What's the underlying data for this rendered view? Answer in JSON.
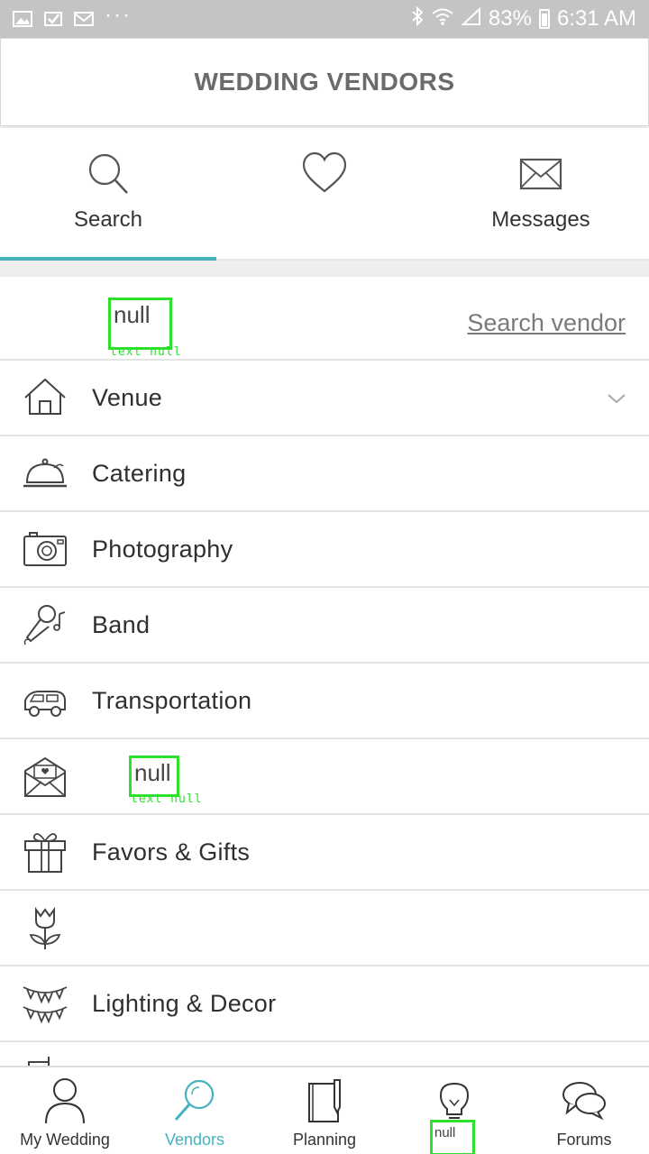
{
  "status_bar": {
    "battery": "83%",
    "time": "6:31 AM",
    "icons": [
      "image-icon",
      "check-icon",
      "gmail-icon",
      "more-dots-icon",
      "bluetooth-icon",
      "wifi-icon",
      "signal-icon",
      "battery-icon"
    ]
  },
  "header": {
    "title": "WEDDING VENDORS"
  },
  "tabs": [
    {
      "label": "Search",
      "icon": "search-icon",
      "active": true
    },
    {
      "label": "",
      "icon": "heart-icon",
      "active": false
    },
    {
      "label": "Messages",
      "icon": "envelope-icon",
      "active": false
    }
  ],
  "search": {
    "null_text": "null",
    "null_caption": "text null",
    "link": "Search vendor"
  },
  "categories": [
    {
      "label": "Venue",
      "icon": "house-icon",
      "expandable": true
    },
    {
      "label": "Catering",
      "icon": "cloche-icon"
    },
    {
      "label": "Photography",
      "icon": "camera-icon"
    },
    {
      "label": "Band",
      "icon": "microphone-icon"
    },
    {
      "label": "Transportation",
      "icon": "car-icon"
    },
    {
      "label": "null",
      "icon": "invitation-icon",
      "caption": "text null"
    },
    {
      "label": "Favors & Gifts",
      "icon": "gift-icon"
    },
    {
      "label": "",
      "icon": "tulip-icon"
    },
    {
      "label": "Lighting & Decor",
      "icon": "bunting-icon"
    }
  ],
  "bottom_nav": [
    {
      "label": "My Wedding",
      "icon": "person-icon"
    },
    {
      "label": "Vendors",
      "icon": "magnifier-icon",
      "active": true
    },
    {
      "label": "Planning",
      "icon": "notebook-icon"
    },
    {
      "label": "null",
      "icon": "lightbulb-icon"
    },
    {
      "label": "Forums",
      "icon": "chat-bubbles-icon"
    }
  ],
  "colors": {
    "accent": "#45b3be",
    "status_bar": "#c4c4c4",
    "null_outline": "#2ee02e",
    "header_text": "#6b6b6b"
  }
}
